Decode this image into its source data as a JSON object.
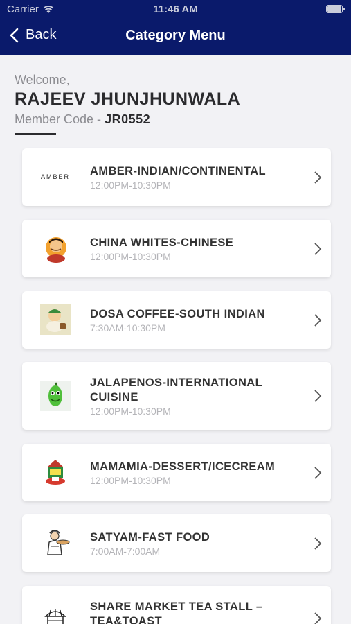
{
  "status": {
    "carrier": "Carrier",
    "time": "11:46 AM"
  },
  "nav": {
    "back_label": "Back",
    "title": "Category Menu"
  },
  "welcome": {
    "greeting": "Welcome,",
    "name": "RAJEEV JHUNJHUNWALA",
    "member_code_label": "Member Code -",
    "member_code": "JR0552"
  },
  "categories": [
    {
      "name": "AMBER-INDIAN/CONTINENTAL",
      "hours": "12:00PM-10:30PM",
      "logo_text": "AMBER"
    },
    {
      "name": "CHINA WHITES-CHINESE",
      "hours": "12:00PM-10:30PM"
    },
    {
      "name": "DOSA COFFEE-SOUTH INDIAN",
      "hours": "7:30AM-10:30PM"
    },
    {
      "name": "JALAPENOS-INTERNATIONAL CUISINE",
      "hours": "12:00PM-10:30PM"
    },
    {
      "name": "MAMAMIA-DESSERT/ICECREAM",
      "hours": "12:00PM-10:30PM"
    },
    {
      "name": "SATYAM-FAST FOOD",
      "hours": "7:00AM-7:00AM"
    },
    {
      "name": "SHARE MARKET TEA STALL – TEA&TOAST",
      "hours": ""
    }
  ],
  "colors": {
    "header": "#0a1a6b",
    "background": "#f2f2f5",
    "card": "#ffffff"
  }
}
